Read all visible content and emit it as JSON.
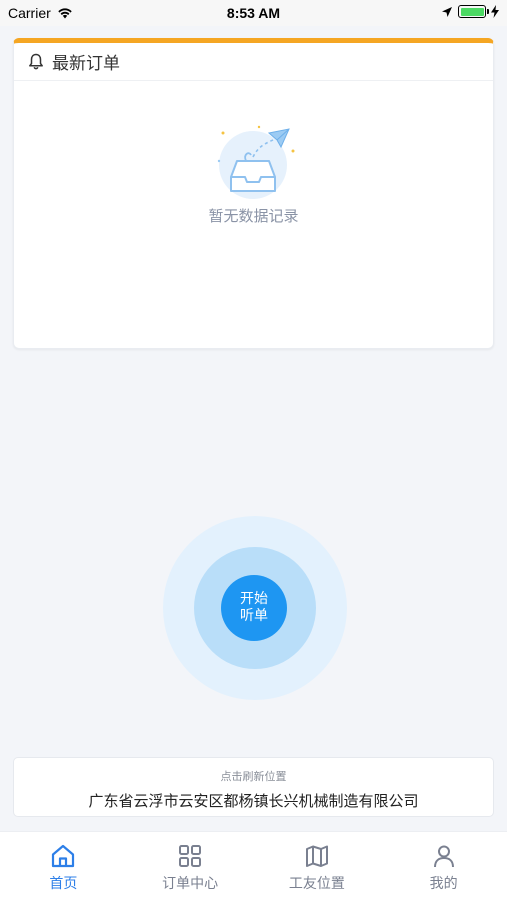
{
  "status_bar": {
    "carrier": "Carrier",
    "time": "8:53 AM",
    "battery_level": 1.0
  },
  "latest_orders": {
    "title": "最新订单",
    "icon": "bell-icon",
    "accent_color": "#f5a623",
    "empty_text": "暂无数据记录"
  },
  "listen_button": {
    "line1": "开始",
    "line2": "听单",
    "color": "#1e96f2"
  },
  "location": {
    "hint": "点击刷新位置",
    "address": "广东省云浮市云安区都杨镇长兴机械制造有限公司"
  },
  "tabs": [
    {
      "label": "首页",
      "icon": "home-icon",
      "active": true
    },
    {
      "label": "订单中心",
      "icon": "grid-icon",
      "active": false
    },
    {
      "label": "工友位置",
      "icon": "map-icon",
      "active": false
    },
    {
      "label": "我的",
      "icon": "user-icon",
      "active": false
    }
  ],
  "colors": {
    "active_tab": "#2d7fe8",
    "inactive_tab": "#7a8090",
    "background": "#f3f5f9"
  }
}
